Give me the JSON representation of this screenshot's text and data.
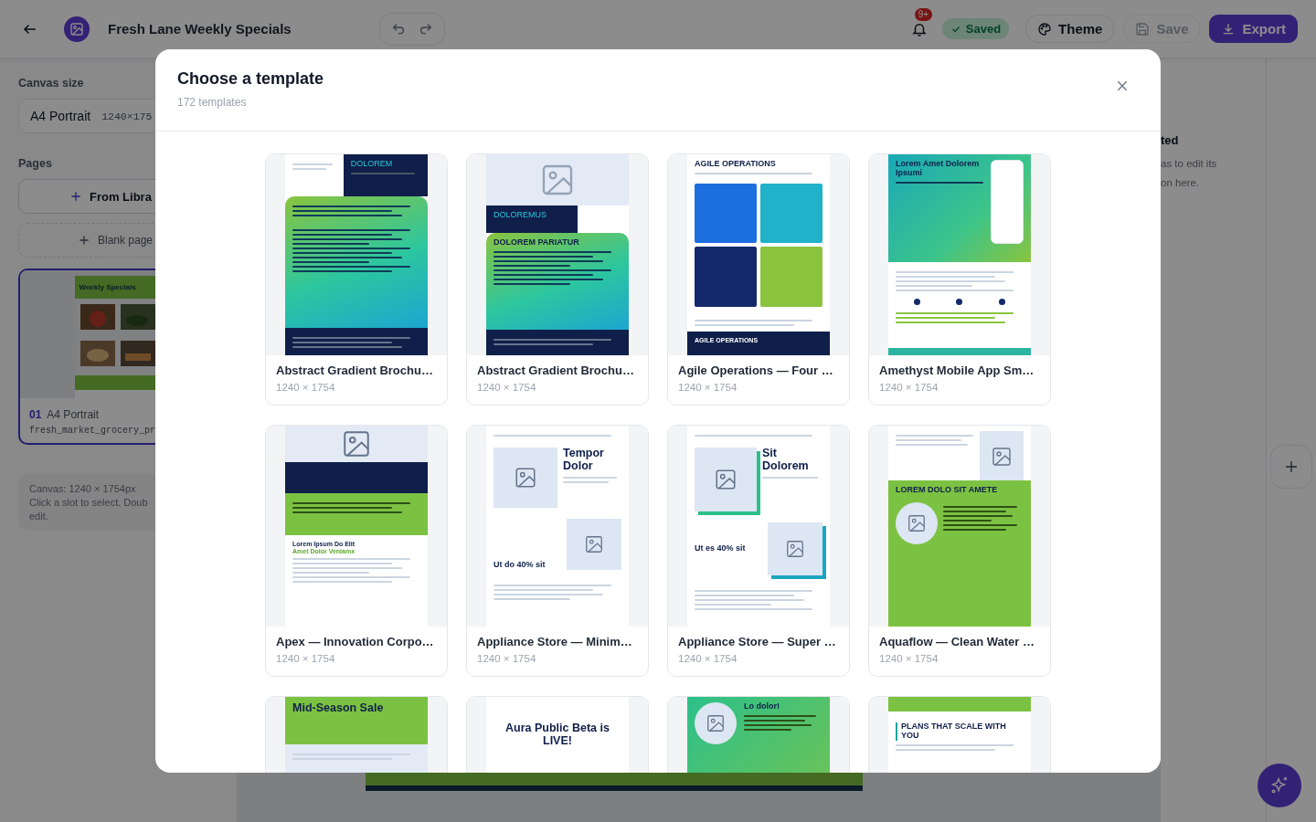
{
  "topbar": {
    "title": "Fresh Lane Weekly Specials",
    "notifications": "9+",
    "status": "Saved",
    "buttons": [
      {
        "label": "Theme",
        "kind": "theme",
        "disabled": false
      },
      {
        "label": "Save",
        "kind": "save",
        "disabled": true
      },
      {
        "label": "Export",
        "kind": "export",
        "disabled": false
      }
    ]
  },
  "sidebar": {
    "canvas_label": "Canvas size",
    "canvas_size": {
      "name": "A4 Portrait",
      "dims": "1240×175"
    },
    "pages_label": "Pages",
    "add_buttons": [
      {
        "label": "From Libra",
        "kind": "library"
      },
      {
        "label": "Blank page",
        "kind": "blank"
      }
    ],
    "pages": [
      {
        "number": "01",
        "name": "A4 Portrait",
        "file": "fresh_market_grocery_pr",
        "headline": "Weekly Specials",
        "selected": true
      }
    ],
    "info": [
      "Canvas: 1240 × 1754px",
      "Click a slot to select. Doub",
      "edit."
    ]
  },
  "right_panel": {
    "title": "ted",
    "text": [
      "as to edit its",
      "on here."
    ]
  },
  "modal": {
    "title": "Choose a template",
    "count": "172 templates",
    "templates": [
      {
        "title": "Abstract Gradient Brochu…",
        "size": "1240 × 1754",
        "kind": "gradient",
        "headlines": [
          "DOLOREM"
        ]
      },
      {
        "title": "Abstract Gradient Brochu…",
        "size": "1240 × 1754",
        "kind": "dark-header",
        "headlines": [
          "DOLOREMUS",
          "DOLOREM PARIATUR"
        ]
      },
      {
        "title": "Agile Operations — Four …",
        "size": "1240 × 1754",
        "kind": "tiles",
        "headlines": [
          "AGILE OPERATIONS",
          "AGILE OPERATIONS"
        ]
      },
      {
        "title": "Amethyst Mobile App Sm…",
        "size": "1240 × 1754",
        "kind": "mobile",
        "headlines": [
          "Lorem Amet Dolorem Ipsumi"
        ]
      },
      {
        "title": "Apex — Innovation Corpo…",
        "size": "1240 × 1754",
        "kind": "banner",
        "headlines": [
          "Lorem Ipsum Do Elit",
          "Amet Dolor Veniamx"
        ]
      },
      {
        "title": "Appliance Store — Minim…",
        "size": "1240 × 1754",
        "kind": "minimal",
        "headlines": [
          "Tempor Dolor",
          "Ut do 40% sit"
        ]
      },
      {
        "title": "Appliance Store — Super …",
        "size": "1240 × 1754",
        "kind": "minimal-accent",
        "headlines": [
          "Sit Dolorem",
          "Ut es 40% sit"
        ]
      },
      {
        "title": "Aquaflow — Clean Water …",
        "size": "1240 × 1754",
        "kind": "green",
        "headlines": [
          "LOREM DOLO SIT AMETE"
        ]
      },
      {
        "kind": "sale",
        "headlines": [
          "Mid-Season Sale"
        ]
      },
      {
        "kind": "announcement",
        "headlines": [
          "Aura Public Beta is LIVE!"
        ]
      },
      {
        "kind": "green-circle",
        "headlines": [
          "Lo dolor!"
        ]
      },
      {
        "kind": "pricing",
        "headlines": [
          "PLANS THAT SCALE WITH YOU"
        ]
      }
    ]
  }
}
